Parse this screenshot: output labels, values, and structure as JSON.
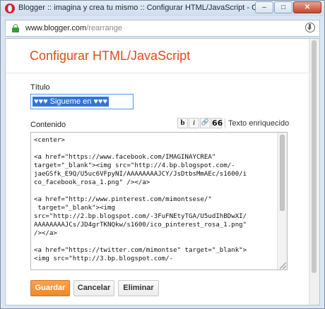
{
  "window": {
    "title": "Blogger :: imagina y crea tu mismo :: Configurar HTML/JavaScript - Opera",
    "minimize_label": "–",
    "maximize_label": "□",
    "close_label": "✕"
  },
  "address_bar": {
    "domain": "www.blogger.com",
    "path": "/rearrange"
  },
  "dialog": {
    "title": "Configurar HTML/JavaScript",
    "titulo_label": "Título",
    "titulo_value": "♥♥♥ Sigueme en ♥♥♥",
    "contenido_label": "Contenido",
    "toolbar": {
      "bold_label": "b",
      "italic_label": "i",
      "link_icon_glyph": "🔗",
      "quote_label": "66",
      "rich_text_label": "Texto enriquecido"
    },
    "content_code": "<center>\n\n<a href=\"https://www.facebook.com/IMAGINAYCREA\"\ntarget=\"_blank\"><img src=\"http://4.bp.blogspot.com/-\njaeGSfk_E9Q/U5uc6VFpyNI/AAAAAAAAJCY/JsDtbsMmAEc/s1600/i\nco_facebook_rosa_1.png\" /></a>\n\n<a href=\"http://www.pinterest.com/mimontsese/\"\n target=\"_blank\"><img\nsrc=\"http://2.bp.blogspot.com/-3FuFNEtyTGA/U5udIhBDwXI/\nAAAAAAAAJCs/JD4grTKNQkw/s1600/ico_pinterest_rosa_1.png\"\n/></a>\n\n<a href=\"https://twitter.com/mimontse\" target=\"_blank\">\n<img src=\"http://3.bp.blogspot.com/-",
    "buttons": {
      "save": "Guardar",
      "cancel": "Cancelar",
      "delete": "Eliminar"
    }
  },
  "colors": {
    "accent_orange": "#dd4b1a",
    "save_button": "#f08a24",
    "selection_blue": "#3375d6"
  }
}
